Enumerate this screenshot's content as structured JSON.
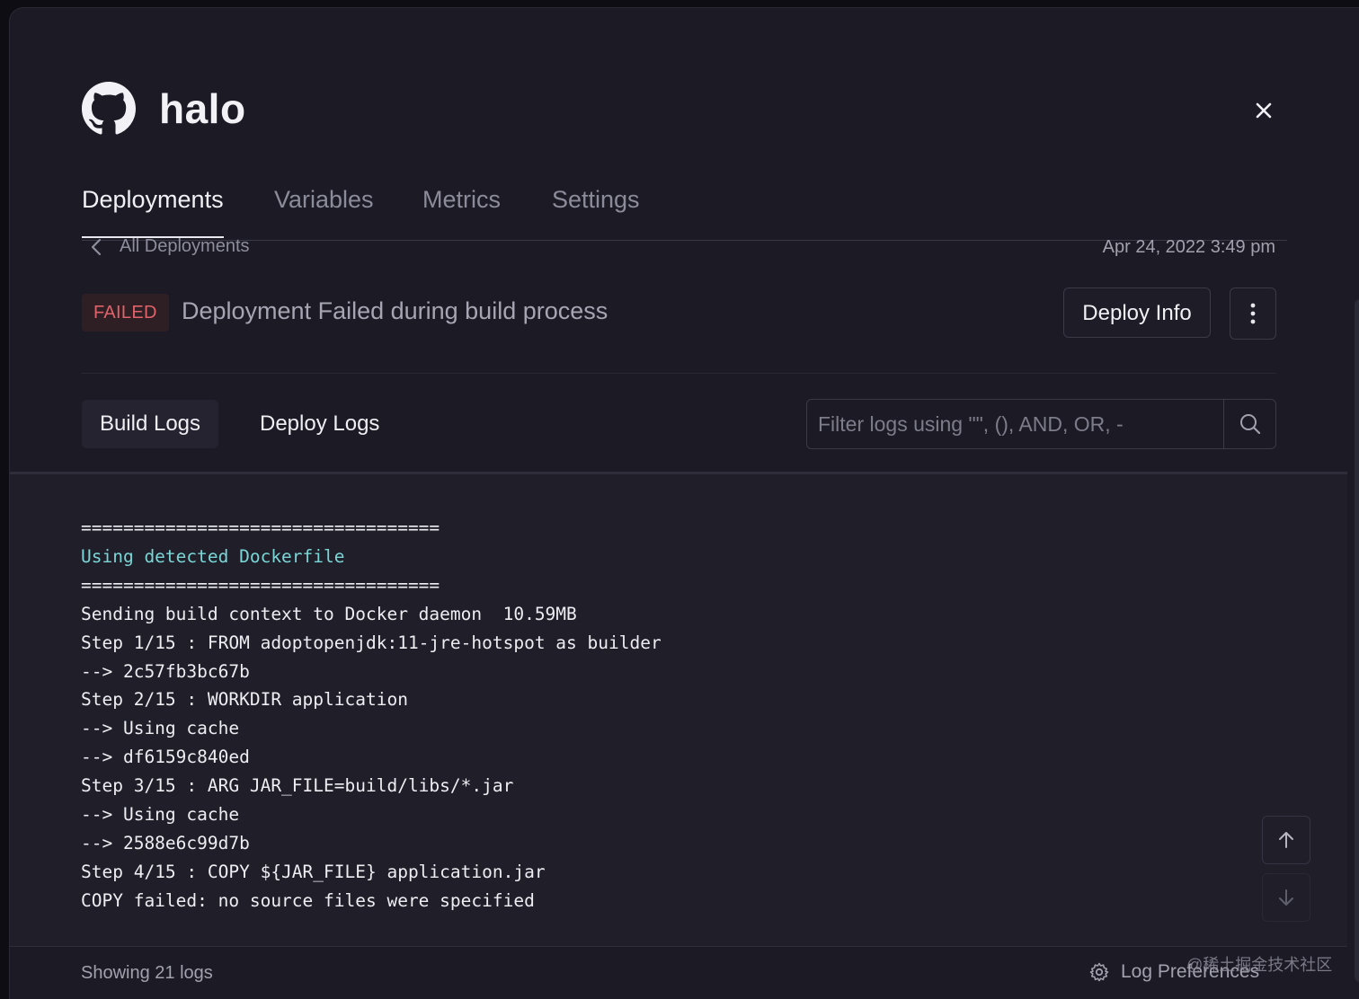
{
  "app": {
    "title": "halo",
    "logo_icon": "github-icon"
  },
  "tabs": [
    {
      "label": "Deployments",
      "active": true
    },
    {
      "label": "Variables",
      "active": false
    },
    {
      "label": "Metrics",
      "active": false
    },
    {
      "label": "Settings",
      "active": false
    }
  ],
  "breadcrumb": {
    "back_label": "All Deployments",
    "date": "Apr 24, 2022 3:49 pm"
  },
  "status": {
    "badge": "FAILED",
    "message": "Deployment Failed during build process",
    "deploy_info_label": "Deploy Info"
  },
  "log_tabs": {
    "build": "Build Logs",
    "deploy": "Deploy Logs"
  },
  "search": {
    "placeholder": "Filter logs using \"\", (), AND, OR, -"
  },
  "logs": [
    {
      "text": "==================================",
      "highlight": false
    },
    {
      "text": "Using detected Dockerfile",
      "highlight": true
    },
    {
      "text": "==================================",
      "highlight": false
    },
    {
      "text": "Sending build context to Docker daemon  10.59MB",
      "highlight": false
    },
    {
      "text": "Step 1/15 : FROM adoptopenjdk:11-jre-hotspot as builder",
      "highlight": false
    },
    {
      "text": "--> 2c57fb3bc67b",
      "highlight": false
    },
    {
      "text": "Step 2/15 : WORKDIR application",
      "highlight": false
    },
    {
      "text": "--> Using cache",
      "highlight": false
    },
    {
      "text": "--> df6159c840ed",
      "highlight": false
    },
    {
      "text": "Step 3/15 : ARG JAR_FILE=build/libs/*.jar",
      "highlight": false
    },
    {
      "text": "--> Using cache",
      "highlight": false
    },
    {
      "text": "--> 2588e6c99d7b",
      "highlight": false
    },
    {
      "text": "Step 4/15 : COPY ${JAR_FILE} application.jar",
      "highlight": false
    },
    {
      "text": "COPY failed: no source files were specified",
      "highlight": false
    }
  ],
  "footer": {
    "count": "Showing 21 logs",
    "prefs_label": "Log Preferences"
  },
  "watermark": "@稀土掘金技术社区",
  "colors": {
    "background": "#1b1a25",
    "failed": "#e0626a",
    "highlight": "#7ad6d6"
  }
}
